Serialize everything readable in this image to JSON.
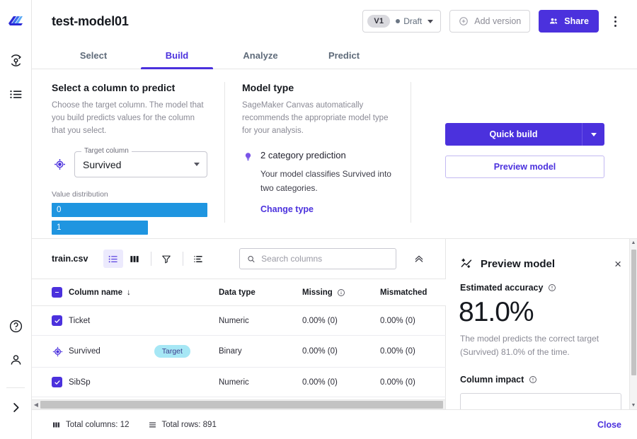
{
  "rail": {
    "logo_name": "sagemaker-canvas-logo",
    "items": [
      {
        "name": "models-icon",
        "label": "My models"
      },
      {
        "name": "datasets-list-icon",
        "label": "Datasets"
      }
    ],
    "bottom_items": [
      {
        "name": "help-icon",
        "label": "Help"
      },
      {
        "name": "account-icon",
        "label": "Account"
      },
      {
        "name": "expand-icon",
        "label": "Expand navigation"
      }
    ]
  },
  "header": {
    "title": "test-model01",
    "version": {
      "chip": "V1",
      "status": "Draft"
    },
    "add_version_label": "Add version",
    "share_label": "Share",
    "more_label": "More options"
  },
  "tabs": [
    {
      "label": "Select",
      "active": false
    },
    {
      "label": "Build",
      "active": true
    },
    {
      "label": "Analyze",
      "active": false
    },
    {
      "label": "Predict",
      "active": false
    }
  ],
  "select_column": {
    "title": "Select a column to predict",
    "description": "Choose the target column. The model that you build predicts values for the column that you select.",
    "target_label": "Target column",
    "target_value": "Survived",
    "distribution_label": "Value distribution",
    "distribution": [
      {
        "value": "0",
        "pct": 100
      },
      {
        "value": "1",
        "pct": 62
      }
    ],
    "bar_color": "#1f95e0"
  },
  "model_type": {
    "title": "Model type",
    "description": "SageMaker Canvas automatically recommends the appropriate model type for your analysis.",
    "recommendation": "2 category prediction",
    "detail": "Your model classifies Survived into two categories.",
    "change_link": "Change type"
  },
  "actions": {
    "quick_build": "Quick build",
    "preview_model": "Preview model",
    "accent": "#4b31dd"
  },
  "grid": {
    "file_name": "train.csv",
    "toolbar_icons": [
      {
        "name": "list-view-icon",
        "selected": true
      },
      {
        "name": "grid-view-icon",
        "selected": false
      },
      {
        "name": "filter-icon",
        "selected": false
      },
      {
        "name": "detail-list-icon",
        "selected": false
      }
    ],
    "search_placeholder": "Search columns",
    "search_value": "",
    "collapse_label": "Collapse",
    "columns": [
      {
        "key": "select",
        "label": ""
      },
      {
        "key": "name",
        "label": "Column name",
        "sort": "↓"
      },
      {
        "key": "type",
        "label": "Data type"
      },
      {
        "key": "missing",
        "label": "Missing",
        "info": true
      },
      {
        "key": "mismatched",
        "label": "Mismatched"
      }
    ],
    "rows": [
      {
        "checked": true,
        "target": false,
        "name": "Ticket",
        "type": "Numeric",
        "missing": "0.00% (0)",
        "mismatched": "0.00% (0)"
      },
      {
        "checked": false,
        "target": true,
        "target_badge": "Target",
        "name": "Survived",
        "type": "Binary",
        "missing": "0.00% (0)",
        "mismatched": "0.00% (0)"
      },
      {
        "checked": true,
        "target": false,
        "name": "SibSp",
        "type": "Numeric",
        "missing": "0.00% (0)",
        "mismatched": "0.00% (0)"
      }
    ]
  },
  "preview": {
    "title": "Preview model",
    "close_label": "×",
    "accuracy_label": "Estimated accuracy",
    "accuracy_value": "81.0%",
    "accuracy_note": "The model predicts the correct target (Survived) 81.0% of the time.",
    "impact_label": "Column impact"
  },
  "status": {
    "total_columns": "Total columns: 12",
    "total_rows": "Total rows: 891",
    "close_label": "Close"
  }
}
